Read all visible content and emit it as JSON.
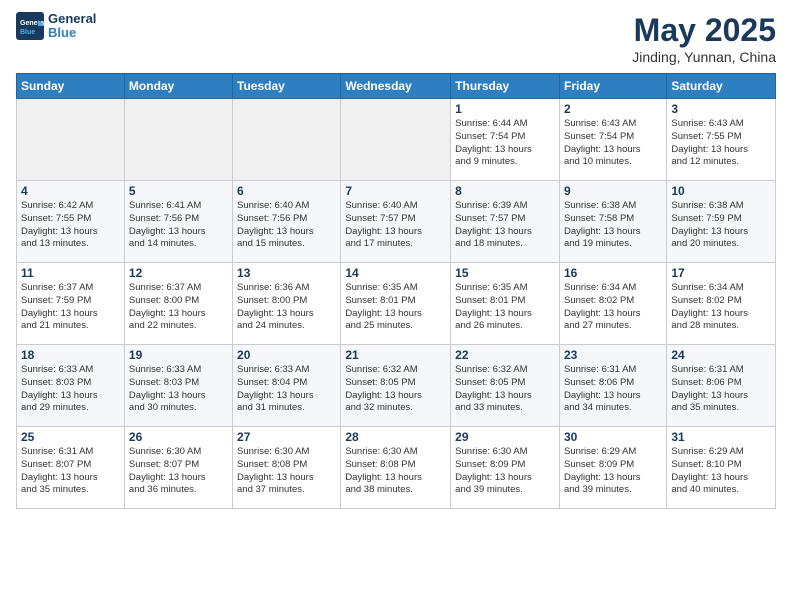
{
  "logo": {
    "line1": "General",
    "line2": "Blue"
  },
  "title": "May 2025",
  "location": "Jinding, Yunnan, China",
  "days_of_week": [
    "Sunday",
    "Monday",
    "Tuesday",
    "Wednesday",
    "Thursday",
    "Friday",
    "Saturday"
  ],
  "weeks": [
    [
      {
        "day": "",
        "info": ""
      },
      {
        "day": "",
        "info": ""
      },
      {
        "day": "",
        "info": ""
      },
      {
        "day": "",
        "info": ""
      },
      {
        "day": "1",
        "info": "Sunrise: 6:44 AM\nSunset: 7:54 PM\nDaylight: 13 hours\nand 9 minutes."
      },
      {
        "day": "2",
        "info": "Sunrise: 6:43 AM\nSunset: 7:54 PM\nDaylight: 13 hours\nand 10 minutes."
      },
      {
        "day": "3",
        "info": "Sunrise: 6:43 AM\nSunset: 7:55 PM\nDaylight: 13 hours\nand 12 minutes."
      }
    ],
    [
      {
        "day": "4",
        "info": "Sunrise: 6:42 AM\nSunset: 7:55 PM\nDaylight: 13 hours\nand 13 minutes."
      },
      {
        "day": "5",
        "info": "Sunrise: 6:41 AM\nSunset: 7:56 PM\nDaylight: 13 hours\nand 14 minutes."
      },
      {
        "day": "6",
        "info": "Sunrise: 6:40 AM\nSunset: 7:56 PM\nDaylight: 13 hours\nand 15 minutes."
      },
      {
        "day": "7",
        "info": "Sunrise: 6:40 AM\nSunset: 7:57 PM\nDaylight: 13 hours\nand 17 minutes."
      },
      {
        "day": "8",
        "info": "Sunrise: 6:39 AM\nSunset: 7:57 PM\nDaylight: 13 hours\nand 18 minutes."
      },
      {
        "day": "9",
        "info": "Sunrise: 6:38 AM\nSunset: 7:58 PM\nDaylight: 13 hours\nand 19 minutes."
      },
      {
        "day": "10",
        "info": "Sunrise: 6:38 AM\nSunset: 7:59 PM\nDaylight: 13 hours\nand 20 minutes."
      }
    ],
    [
      {
        "day": "11",
        "info": "Sunrise: 6:37 AM\nSunset: 7:59 PM\nDaylight: 13 hours\nand 21 minutes."
      },
      {
        "day": "12",
        "info": "Sunrise: 6:37 AM\nSunset: 8:00 PM\nDaylight: 13 hours\nand 22 minutes."
      },
      {
        "day": "13",
        "info": "Sunrise: 6:36 AM\nSunset: 8:00 PM\nDaylight: 13 hours\nand 24 minutes."
      },
      {
        "day": "14",
        "info": "Sunrise: 6:35 AM\nSunset: 8:01 PM\nDaylight: 13 hours\nand 25 minutes."
      },
      {
        "day": "15",
        "info": "Sunrise: 6:35 AM\nSunset: 8:01 PM\nDaylight: 13 hours\nand 26 minutes."
      },
      {
        "day": "16",
        "info": "Sunrise: 6:34 AM\nSunset: 8:02 PM\nDaylight: 13 hours\nand 27 minutes."
      },
      {
        "day": "17",
        "info": "Sunrise: 6:34 AM\nSunset: 8:02 PM\nDaylight: 13 hours\nand 28 minutes."
      }
    ],
    [
      {
        "day": "18",
        "info": "Sunrise: 6:33 AM\nSunset: 8:03 PM\nDaylight: 13 hours\nand 29 minutes."
      },
      {
        "day": "19",
        "info": "Sunrise: 6:33 AM\nSunset: 8:03 PM\nDaylight: 13 hours\nand 30 minutes."
      },
      {
        "day": "20",
        "info": "Sunrise: 6:33 AM\nSunset: 8:04 PM\nDaylight: 13 hours\nand 31 minutes."
      },
      {
        "day": "21",
        "info": "Sunrise: 6:32 AM\nSunset: 8:05 PM\nDaylight: 13 hours\nand 32 minutes."
      },
      {
        "day": "22",
        "info": "Sunrise: 6:32 AM\nSunset: 8:05 PM\nDaylight: 13 hours\nand 33 minutes."
      },
      {
        "day": "23",
        "info": "Sunrise: 6:31 AM\nSunset: 8:06 PM\nDaylight: 13 hours\nand 34 minutes."
      },
      {
        "day": "24",
        "info": "Sunrise: 6:31 AM\nSunset: 8:06 PM\nDaylight: 13 hours\nand 35 minutes."
      }
    ],
    [
      {
        "day": "25",
        "info": "Sunrise: 6:31 AM\nSunset: 8:07 PM\nDaylight: 13 hours\nand 35 minutes."
      },
      {
        "day": "26",
        "info": "Sunrise: 6:30 AM\nSunset: 8:07 PM\nDaylight: 13 hours\nand 36 minutes."
      },
      {
        "day": "27",
        "info": "Sunrise: 6:30 AM\nSunset: 8:08 PM\nDaylight: 13 hours\nand 37 minutes."
      },
      {
        "day": "28",
        "info": "Sunrise: 6:30 AM\nSunset: 8:08 PM\nDaylight: 13 hours\nand 38 minutes."
      },
      {
        "day": "29",
        "info": "Sunrise: 6:30 AM\nSunset: 8:09 PM\nDaylight: 13 hours\nand 39 minutes."
      },
      {
        "day": "30",
        "info": "Sunrise: 6:29 AM\nSunset: 8:09 PM\nDaylight: 13 hours\nand 39 minutes."
      },
      {
        "day": "31",
        "info": "Sunrise: 6:29 AM\nSunset: 8:10 PM\nDaylight: 13 hours\nand 40 minutes."
      }
    ]
  ]
}
